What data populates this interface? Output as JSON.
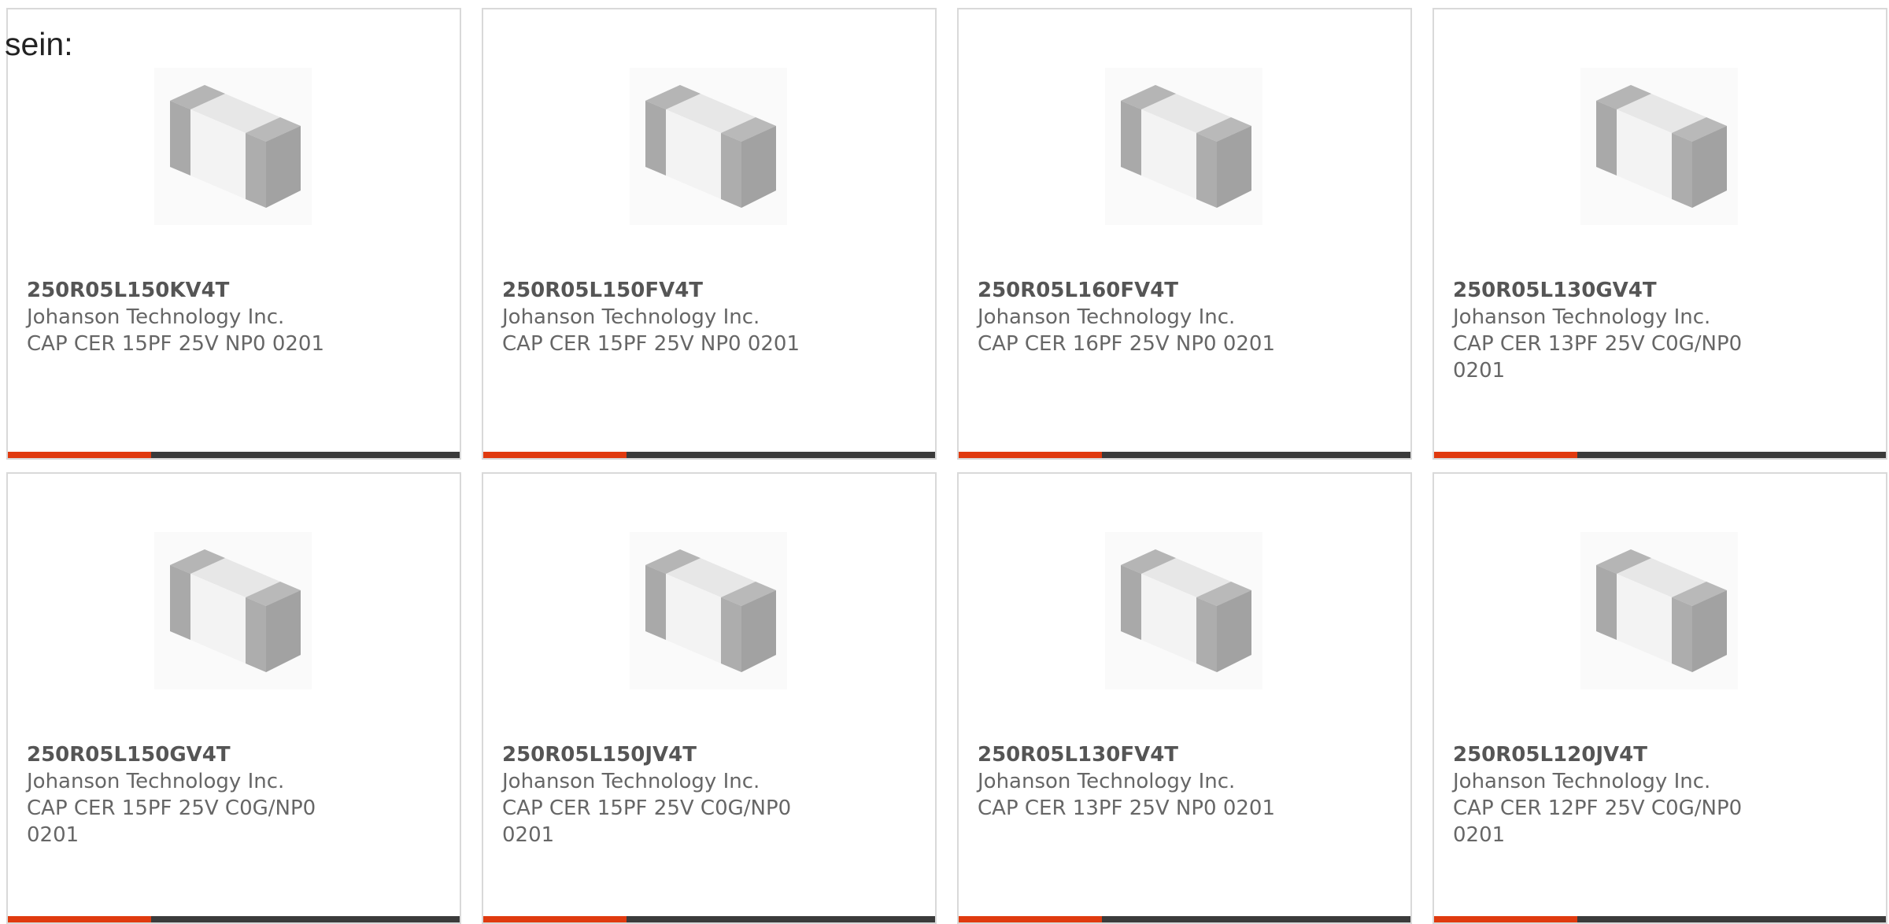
{
  "intro_text": "sein:",
  "colors": {
    "accent": "#e03a0f",
    "bar": "#3b3b3b",
    "text": "#666666",
    "border": "#d9d9d9"
  },
  "image_icon": "chip-capacitor-image",
  "products": [
    {
      "part_number": "250R05L150KV4T",
      "manufacturer": "Johanson Technology Inc.",
      "description": "CAP CER 15PF 25V NP0 0201"
    },
    {
      "part_number": "250R05L150FV4T",
      "manufacturer": "Johanson Technology Inc.",
      "description": "CAP CER 15PF 25V NP0 0201"
    },
    {
      "part_number": "250R05L160FV4T",
      "manufacturer": "Johanson Technology Inc.",
      "description": "CAP CER 16PF 25V NP0 0201"
    },
    {
      "part_number": "250R05L130GV4T",
      "manufacturer": "Johanson Technology Inc.",
      "description": "CAP CER 13PF 25V C0G/NP0 0201"
    },
    {
      "part_number": "250R05L150GV4T",
      "manufacturer": "Johanson Technology Inc.",
      "description": "CAP CER 15PF 25V C0G/NP0 0201"
    },
    {
      "part_number": "250R05L150JV4T",
      "manufacturer": "Johanson Technology Inc.",
      "description": "CAP CER 15PF 25V C0G/NP0 0201"
    },
    {
      "part_number": "250R05L130FV4T",
      "manufacturer": "Johanson Technology Inc.",
      "description": "CAP CER 13PF 25V NP0 0201"
    },
    {
      "part_number": "250R05L120JV4T",
      "manufacturer": "Johanson Technology Inc.",
      "description": "CAP CER 12PF 25V C0G/NP0 0201"
    }
  ]
}
